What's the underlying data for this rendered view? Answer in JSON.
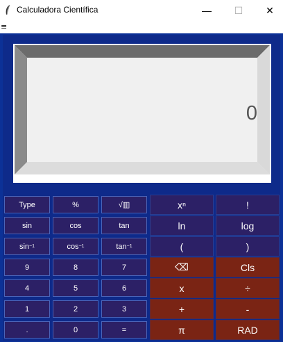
{
  "window": {
    "title": "Calculadora Científica",
    "minimize": "—",
    "maximize": "☐",
    "close": "✕"
  },
  "menu": {
    "icon": "≡"
  },
  "display": {
    "value": "0"
  },
  "buttons": {
    "type": "Type",
    "percent": "%",
    "sqrt": "√▥",
    "power": "xⁿ",
    "factorial": "!",
    "sin": "sin",
    "cos": "cos",
    "tan": "tan",
    "ln": "ln",
    "log": "log",
    "asin_base": "sin",
    "asin_sup": "−1",
    "acos_base": "cos",
    "acos_sup": "−1",
    "atan_base": "tan",
    "atan_sup": "−1",
    "lparen": "(",
    "rparen": ")",
    "nine": "9",
    "eight": "8",
    "seven": "7",
    "backspace": "⌫",
    "clear": "Cls",
    "four": "4",
    "five": "5",
    "six": "6",
    "multiply": "x",
    "divide": "÷",
    "one": "1",
    "two": "2",
    "three": "3",
    "plus": "+",
    "minus": "-",
    "dot": ".",
    "zero": "0",
    "equals": "=",
    "pi": "π",
    "rad": "RAD"
  },
  "colors": {
    "background": "#0c3197",
    "small_button": "#2c2066",
    "operator_button": "#7a2414",
    "display": "#f0f0f0"
  }
}
